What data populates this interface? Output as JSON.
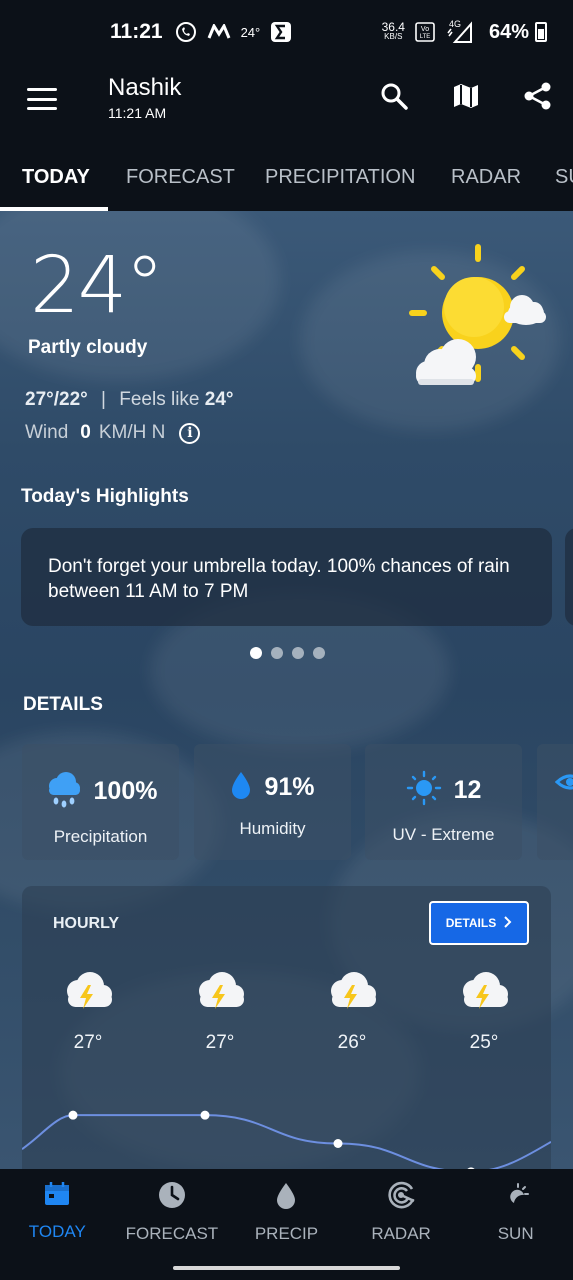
{
  "status_bar": {
    "time": "11:21",
    "notif_temp": "24°",
    "net_speed_value": "36.4",
    "net_speed_unit": "KB/S",
    "volte": "VoLTE",
    "network": "4G",
    "battery": "64%"
  },
  "app_bar": {
    "location": "Nashik",
    "time": "11:21 AM"
  },
  "tabs": [
    "TODAY",
    "FORECAST",
    "PRECIPITATION",
    "RADAR",
    "SU"
  ],
  "current": {
    "temperature": "24°",
    "condition": "Partly cloudy",
    "high_low": "27°/22°",
    "separator": "|",
    "feels_like_label": "Feels like",
    "feels_like_value": "24°",
    "wind_label": "Wind",
    "wind_value": "0",
    "wind_unit": "KM/H N",
    "info_icon": "i"
  },
  "highlights": {
    "title": "Today's Highlights",
    "message": "Don't forget your umbrella today. 100% chances of rain between 11 AM to 7 PM",
    "page_count": 4,
    "active_page": 0
  },
  "details": {
    "title": "DETAILS",
    "cards": [
      {
        "value": "100%",
        "label": "Precipitation",
        "icon": "rain-cloud-icon"
      },
      {
        "value": "91%",
        "label": "Humidity",
        "icon": "droplet-icon"
      },
      {
        "value": "12",
        "label": "UV - Extreme",
        "icon": "sun-icon"
      }
    ]
  },
  "hourly": {
    "title": "HOURLY",
    "button_label": "DETAILS",
    "items": [
      {
        "temp": "27°",
        "icon": "thunderstorm-icon"
      },
      {
        "temp": "27°",
        "icon": "thunderstorm-icon"
      },
      {
        "temp": "26°",
        "icon": "thunderstorm-icon"
      },
      {
        "temp": "25°",
        "icon": "thunderstorm-icon"
      }
    ],
    "series": [
      27,
      27,
      26,
      25
    ]
  },
  "bottom_nav": [
    {
      "label": "TODAY",
      "icon": "calendar-icon"
    },
    {
      "label": "FORECAST",
      "icon": "clock-icon"
    },
    {
      "label": "PRECIP",
      "icon": "droplet-icon"
    },
    {
      "label": "RADAR",
      "icon": "radar-icon"
    },
    {
      "label": "SUN",
      "icon": "moon-sun-icon"
    }
  ],
  "colors": {
    "accent": "#1f86f2",
    "button": "#1668e6",
    "bar": "#0c1118"
  }
}
